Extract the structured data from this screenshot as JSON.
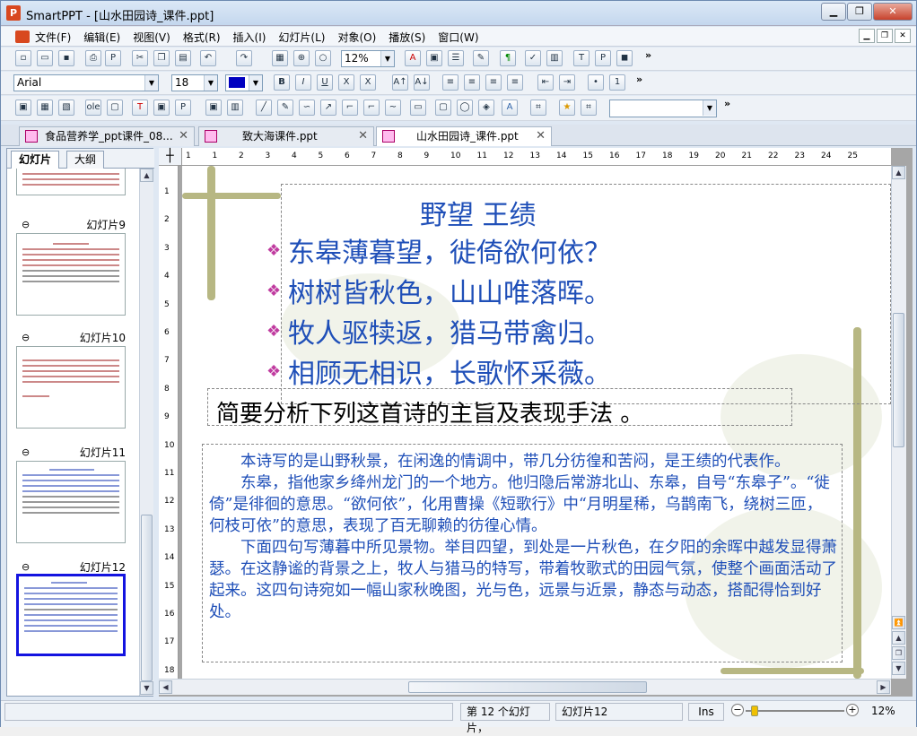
{
  "window": {
    "title": "SmartPPT - [山水田园诗_课件.ppt]",
    "app_icon": "P"
  },
  "menu": [
    "文件(F)",
    "编辑(E)",
    "视图(V)",
    "格式(R)",
    "插入(I)",
    "幻灯片(L)",
    "对象(O)",
    "播放(S)",
    "窗口(W)"
  ],
  "toolbar": {
    "zoom": "12%",
    "font": "Arial",
    "size": "18",
    "more": "»"
  },
  "doc_tabs": [
    {
      "label": "食品营养学_ppt课件_08...",
      "active": false
    },
    {
      "label": "致大海课件.ppt",
      "active": false
    },
    {
      "label": "山水田园诗_课件.ppt",
      "active": true
    }
  ],
  "left_panel": {
    "tabs": [
      "幻灯片",
      "大纲"
    ],
    "slides": [
      "幻灯片9",
      "幻灯片10",
      "幻灯片11",
      "幻灯片12"
    ]
  },
  "slide": {
    "title": "野望  王绩",
    "lines": [
      "东皋薄暮望，徙倚欲何依？",
      "树树皆秋色，山山唯落晖。",
      "牧人驱犊返，猎马带禽归。",
      "相顾无相识，长歌怀采薇。"
    ],
    "question": "简要分析下列这首诗的主旨及表现手法 。",
    "analysis": [
      "本诗写的是山野秋景，在闲逸的情调中，带几分彷徨和苦闷，是王绩的代表作。",
      "东皋，指他家乡绛州龙门的一个地方。他归隐后常游北山、东皋，自号“东皋子”。“徙倚”是徘徊的意思。“欲何依”，化用曹操《短歌行》中“月明星稀，乌鹊南飞，绕树三匝，何枝可依”的意思，表现了百无聊赖的彷徨心情。",
      "下面四句写薄暮中所见景物。举目四望，到处是一片秋色，在夕阳的余晖中越发显得萧瑟。在这静谧的背景之上，牧人与猎马的特写，带着牧歌式的田园气氛，使整个画面活动了起来。这四句诗宛如一幅山家秋晚图，光与色，远景与近景，静态与动态，搭配得恰到好处。"
    ]
  },
  "hruler": [
    "1",
    "1",
    "2",
    "3",
    "4",
    "5",
    "6",
    "7",
    "8",
    "9",
    "10",
    "11",
    "12",
    "13",
    "14",
    "15",
    "16",
    "17",
    "18",
    "19",
    "20",
    "21",
    "22",
    "23",
    "24",
    "25"
  ],
  "vruler": [
    "1",
    "2",
    "3",
    "4",
    "5",
    "6",
    "7",
    "8",
    "9",
    "10",
    "11",
    "12",
    "13",
    "14",
    "15",
    "16",
    "17",
    "18"
  ],
  "status": {
    "count": "第 12 个幻灯片，",
    "current": "幻灯片12",
    "mode": "Ins",
    "zoom": "12%"
  }
}
